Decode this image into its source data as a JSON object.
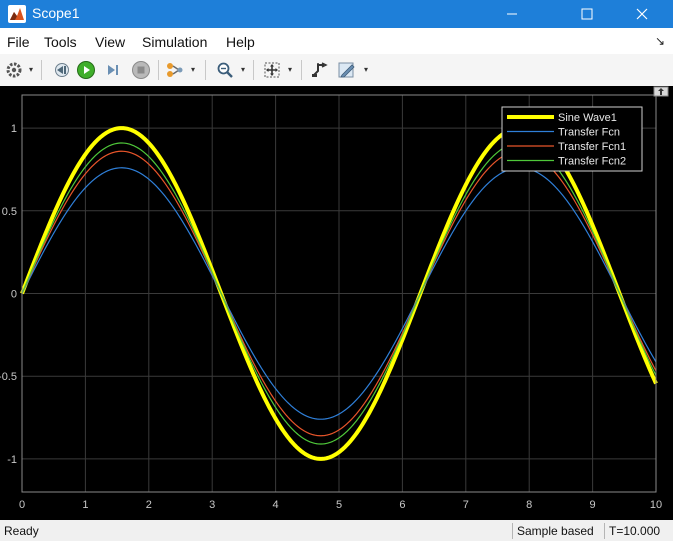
{
  "window": {
    "title": "Scope1",
    "controls": [
      "minimize",
      "maximize",
      "close"
    ]
  },
  "menubar": {
    "items": [
      "File",
      "Tools",
      "View",
      "Simulation",
      "Help"
    ]
  },
  "toolbar": {
    "icons": [
      "gear-icon",
      "step-back-icon",
      "run-icon",
      "step-forward-icon",
      "stop-icon",
      "highlight-icon",
      "zoom-icon",
      "fit-to-view-icon",
      "cursor-measure-icon",
      "edit-icon"
    ]
  },
  "status": {
    "left": "Ready",
    "mode": "Sample based",
    "time": "T=10.000"
  },
  "chart_data": {
    "type": "line",
    "title": "",
    "xlabel": "",
    "ylabel": "",
    "xlim": [
      0,
      10
    ],
    "ylim": [
      -1.2,
      1.2
    ],
    "xticks": [
      "0",
      "1",
      "2",
      "3",
      "4",
      "5",
      "6",
      "7",
      "8",
      "9",
      "10"
    ],
    "yticks": [
      "1",
      "0.5",
      "0",
      "-0.5",
      "-1"
    ],
    "grid": true,
    "legend_position": "top-right",
    "background": "#000000",
    "series": [
      {
        "name": "Sine Wave1",
        "color": "#ffff00",
        "width": 4,
        "amplitude": 1.0,
        "phase": 0.0,
        "x": [
          0,
          1.571,
          3.142,
          4.712,
          6.283,
          7.854,
          10
        ],
        "y": [
          0,
          1.0,
          0,
          -1.0,
          0,
          1.0,
          -0.54
        ]
      },
      {
        "name": "Transfer Fcn",
        "color": "#2f7fd8",
        "width": 1.2,
        "amplitude": 0.76,
        "phase": 0.0,
        "x": [
          0,
          1.571,
          3.142,
          4.712,
          6.283,
          7.854,
          10
        ],
        "y": [
          0,
          0.76,
          0,
          -0.76,
          0,
          0.76,
          -0.46
        ]
      },
      {
        "name": "Transfer Fcn1",
        "color": "#e8552a",
        "width": 1.2,
        "amplitude": 0.86,
        "phase": 0.0,
        "x": [
          0,
          1.571,
          3.142,
          4.712,
          6.283,
          7.854,
          10
        ],
        "y": [
          0,
          0.86,
          0,
          -0.86,
          0,
          0.86,
          -0.49
        ]
      },
      {
        "name": "Transfer Fcn2",
        "color": "#4fc83a",
        "width": 1.2,
        "amplitude": 0.91,
        "phase": 0.0,
        "x": [
          0,
          1.571,
          3.142,
          4.712,
          6.283,
          7.854,
          10
        ],
        "y": [
          0,
          0.91,
          0,
          -0.91,
          0,
          0.91,
          -0.5
        ]
      }
    ]
  }
}
